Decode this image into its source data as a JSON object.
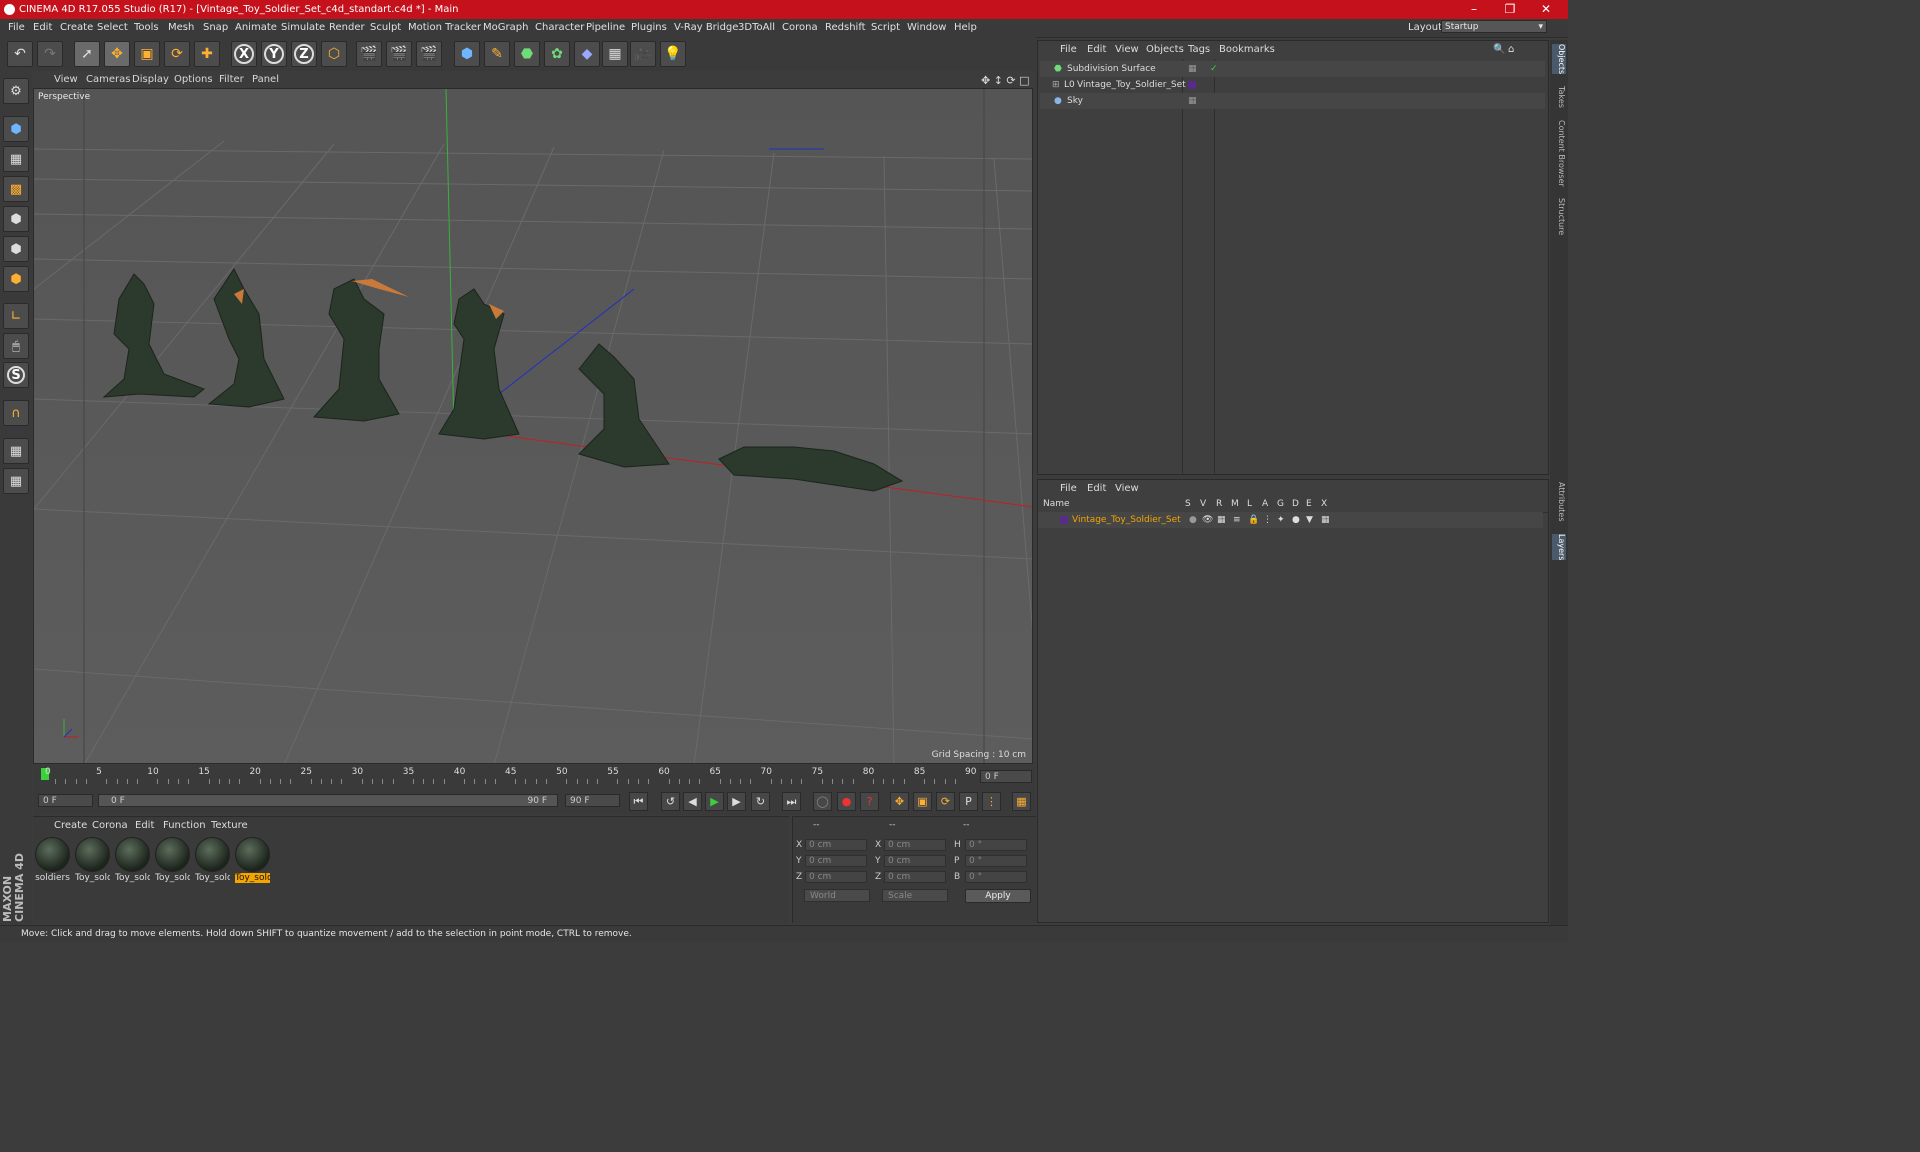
{
  "title": "CINEMA 4D R17.055 Studio (R17) - [Vintage_Toy_Soldier_Set_c4d_standart.c4d *] - Main",
  "menu": [
    "File",
    "Edit",
    "Create",
    "Select",
    "Tools",
    "Mesh",
    "Snap",
    "Animate",
    "Simulate",
    "Render",
    "Sculpt",
    "Motion Tracker",
    "MoGraph",
    "Character",
    "Pipeline",
    "Plugins",
    "V-Ray Bridge",
    "3DToAll",
    "Corona",
    "Redshift",
    "Script",
    "Window",
    "Help"
  ],
  "layout": {
    "label": "Layout:",
    "value": "Startup"
  },
  "viewport": {
    "menu": [
      "View",
      "Cameras",
      "Display",
      "Options",
      "Filter",
      "Panel"
    ],
    "label": "Perspective",
    "grid_spacing": "Grid Spacing : 10 cm"
  },
  "timeline": {
    "ticks": [
      "0",
      "5",
      "10",
      "15",
      "20",
      "25",
      "30",
      "35",
      "40",
      "45",
      "50",
      "55",
      "60",
      "65",
      "70",
      "75",
      "80",
      "85",
      "90"
    ],
    "current": "0 F",
    "start": "0 F",
    "range_start": "0 F",
    "range_end": "90 F",
    "end": "90 F"
  },
  "materials": {
    "menu": [
      "Create",
      "Corona",
      "Edit",
      "Function",
      "Texture"
    ],
    "items": [
      "soldiers",
      "Toy_sold",
      "Toy_sold",
      "Toy_sold",
      "Toy_sold",
      "Toy_sold"
    ]
  },
  "coords": {
    "headers": [
      "--",
      "--",
      "--"
    ],
    "rows": [
      {
        "a": "X",
        "av": "0 cm",
        "b": "X",
        "bv": "0 cm",
        "c": "H",
        "cv": "0 °"
      },
      {
        "a": "Y",
        "av": "0 cm",
        "b": "Y",
        "bv": "0 cm",
        "c": "P",
        "cv": "0 °"
      },
      {
        "a": "Z",
        "av": "0 cm",
        "b": "Z",
        "bv": "0 cm",
        "c": "B",
        "cv": "0 °"
      }
    ],
    "world": "World",
    "scale": "Scale",
    "apply": "Apply"
  },
  "objects": {
    "menu": [
      "File",
      "Edit",
      "View",
      "Objects",
      "Tags",
      "Bookmarks"
    ],
    "items": [
      "Subdivision Surface",
      "Vintage_Toy_Soldier_Set",
      "Sky"
    ]
  },
  "layers": {
    "menu": [
      "File",
      "Edit",
      "View"
    ],
    "name_header": "Name",
    "cols": [
      "S",
      "V",
      "R",
      "M",
      "L",
      "A",
      "G",
      "D",
      "E",
      "X"
    ],
    "items": [
      "Vintage_Toy_Soldier_Set"
    ]
  },
  "side_tabs": [
    "Objects",
    "Takes",
    "Content Browser",
    "Structure",
    "Attributes",
    "Layers"
  ],
  "brand": "MAXON CINEMA 4D",
  "status": "Move: Click and drag to move elements. Hold down SHIFT to quantize movement / add to the selection in point mode, CTRL to remove.",
  "colors": {
    "titlebar": "#c4111b",
    "selection": "#f4a500",
    "layer_name": "#f4a500"
  }
}
